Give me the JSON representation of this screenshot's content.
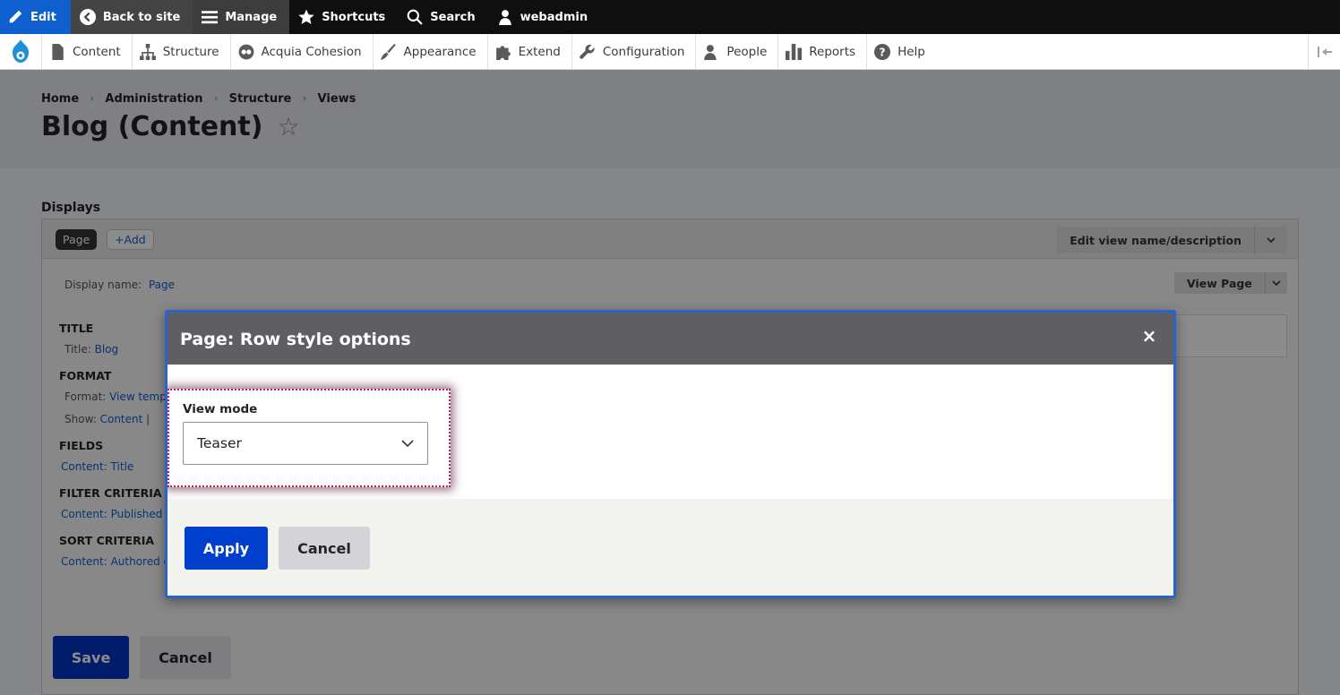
{
  "toolbar": {
    "edit": "Edit",
    "back": "Back to site",
    "manage": "Manage",
    "shortcuts": "Shortcuts",
    "search": "Search",
    "user": "webadmin"
  },
  "tray": {
    "items": [
      "Content",
      "Structure",
      "Acquia Cohesion",
      "Appearance",
      "Extend",
      "Configuration",
      "People",
      "Reports",
      "Help"
    ]
  },
  "breadcrumb": [
    "Home",
    "Administration",
    "Structure",
    "Views"
  ],
  "page_title": "Blog (Content)",
  "displays": {
    "label": "Displays",
    "tab_page": "Page",
    "tab_add": "Add",
    "edit_name": "Edit view name/description",
    "display_name_label": "Display name:",
    "display_name_value": "Page",
    "view_page": "View Page",
    "sections": {
      "title_h": "TITLE",
      "title_label": "Title:",
      "title_value": "Blog",
      "format_h": "FORMAT",
      "format_label": "Format:",
      "format_value": "View templ",
      "show_label": "Show:",
      "show_value": "Content",
      "show_sep": "|",
      "fields_h": "FIELDS",
      "fields_value": "Content: Title",
      "filter_h": "FILTER CRITERIA",
      "filter_value": "Content: Published (",
      "sort_h": "SORT CRITERIA",
      "sort_value": "Content: Authored o"
    },
    "save": "Save",
    "cancel": "Cancel"
  },
  "dialog": {
    "title": "Page: Row style options",
    "close": "×",
    "view_mode_label": "View mode",
    "view_mode_value": "Teaser",
    "apply": "Apply",
    "cancel": "Cancel"
  },
  "colors": {
    "primary_button": "#003ecc",
    "highlight_border": "#c8176a",
    "dialog_border": "#2a63c9"
  }
}
